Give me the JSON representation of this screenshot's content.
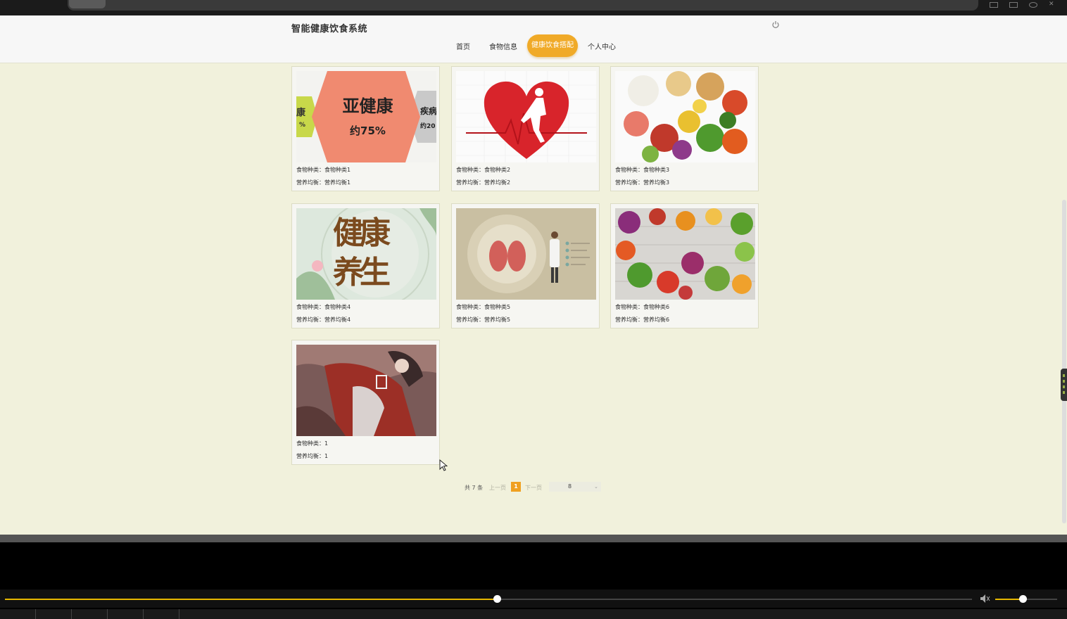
{
  "header": {
    "site_title": "智能健康饮食系统",
    "nav": [
      {
        "label": "首页",
        "active": false
      },
      {
        "label": "食物信息",
        "active": false
      },
      {
        "label": "健康饮食搭配",
        "active": true
      },
      {
        "label": "个人中心",
        "active": false
      }
    ]
  },
  "cards": [
    {
      "line1": "食物种类：食物种类1",
      "line2": "营养均衡：营养均衡1",
      "image": "亚健康 约75% infographic"
    },
    {
      "line1": "食物种类：食物种类2",
      "line2": "营养均衡：营养均衡2",
      "image": "heart with runner"
    },
    {
      "line1": "食物种类：食物种类3",
      "line2": "营养均衡：营养均衡3",
      "image": "assorted foods"
    },
    {
      "line1": "食物种类：食物种类4",
      "line2": "营养均衡：营养均衡4",
      "image": "健康养生 calligraphy"
    },
    {
      "line1": "食物种类：食物种类5",
      "line2": "营养均衡：营养均衡5",
      "image": "kidney doctor illustration"
    },
    {
      "line1": "食物种类：食物种类6",
      "line2": "营养均衡：营养均衡6",
      "image": "vegetables on wood"
    },
    {
      "line1": "食物种类：1",
      "line2": "营养均衡：1",
      "image": "anime artwork"
    }
  ],
  "card_texts": {
    "c1": {
      "big": "亚健康",
      "pct": "约75%",
      "left": "康",
      "left2": "%",
      "right": "疾病",
      "right2": "约20"
    },
    "c4": {
      "calligraphy": "健康养生"
    }
  },
  "pagination": {
    "total": "共 7 条",
    "prev": "上一页",
    "current": "1",
    "next": "下一页",
    "page_size": "8"
  },
  "player": {
    "progress": 0.509,
    "volume": 0.44
  },
  "colors": {
    "page_bg": "#f1f1dc",
    "accent": "#f0aa28",
    "progress": "#e6b800"
  },
  "icons": [
    "power-icon",
    "volume-icon",
    "chevron-down-icon",
    "mouse-cursor-icon"
  ]
}
